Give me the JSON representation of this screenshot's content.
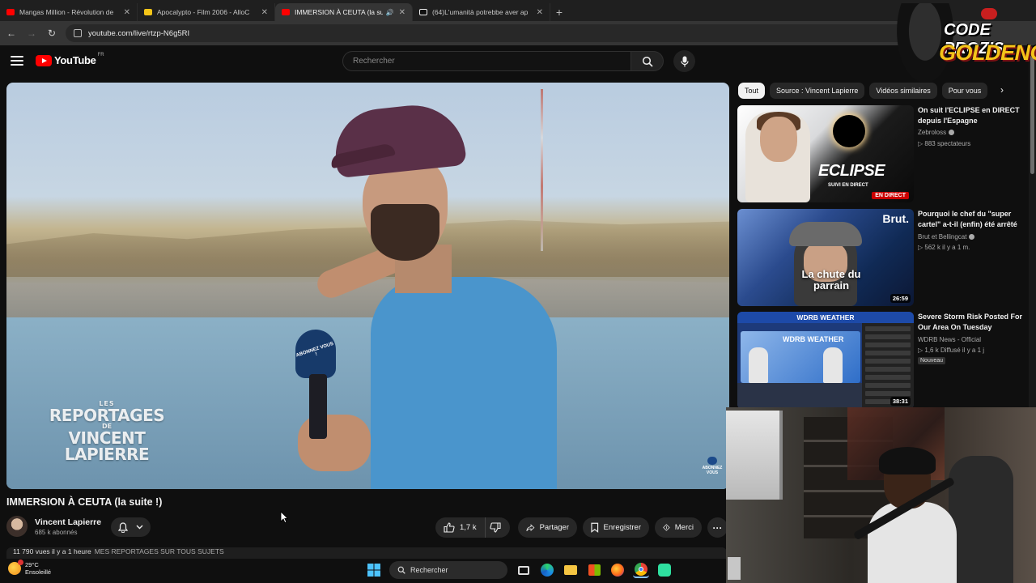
{
  "browser": {
    "tabs": [
      {
        "title": "Mangas Million - Révolution de",
        "favicon_color": "#ff0000",
        "active": false
      },
      {
        "title": "Apocalypto - Film 2006 - AlloC",
        "favicon_color": "#f5c518",
        "active": false
      },
      {
        "title": "IMMERSION À CEUTA (la su",
        "favicon_color": "#ff0000",
        "active": true,
        "audio": true
      },
      {
        "title": "(64)L'umanità potrebbe aver ap",
        "favicon_color": "#ffffff",
        "active": false
      }
    ],
    "url": "youtube.com/live/rtzp-N6g5RI"
  },
  "youtube": {
    "logo_text": "YouTube",
    "country_code": "FR",
    "search_placeholder": "Rechercher"
  },
  "video": {
    "watermark": {
      "line1": "LES",
      "line2": "REPORTAGES",
      "line3": "DE",
      "line4": "VINCENT LAPIERRE"
    },
    "mic_text": "ABONNEZ VOUS !",
    "corner_text": "ABONNEZ VOUS",
    "title": "IMMERSION À CEUTA (la suite !)",
    "channel": "Vincent Lapierre",
    "subscribers": "685 k abonnés",
    "likes": "1,7 k",
    "share_label": "Partager",
    "save_label": "Enregistrer",
    "thanks_label": "Merci",
    "description_start": "11 790 vues  il y a 1 heure",
    "description_link": "MES REPORTAGES SUR TOUS SUJETS"
  },
  "chips": [
    "Tout",
    "Source : Vincent Lapierre",
    "Vidéos similaires",
    "Pour vous"
  ],
  "recommendations": [
    {
      "title": "On suit l'ECLIPSE en DIRECT depuis l'Espagne",
      "channel": "Zebrolоss",
      "verified": true,
      "meta": "▷ 883 spectateurs",
      "thumb_word": "ECLIPSE",
      "thumb_sub": "SUIVI EN DIRECT",
      "badge": "EN DIRECT"
    },
    {
      "title": "Pourquoi le chef du \"super cartel\" a-t-il (enfin) été arrêté",
      "channel": "Brut et Bellingcat",
      "verified": true,
      "meta": "▷ 562 k  il y a 1 m.",
      "thumb_brand": "Brut.",
      "thumb_caption": "La chute du parrain",
      "duration": "26:59"
    },
    {
      "title": "Severe Storm Risk Posted For Our Area On Tuesday",
      "channel": "WDRB News - Official",
      "verified": false,
      "meta": "▷ 1,6 k  Diffusé il y a 1 j",
      "tag": "Nouveau",
      "thumb_banner": "WDRB WEATHER",
      "thumb_screen": "WDRB WEATHER",
      "duration": "38:31"
    }
  ],
  "overlay": {
    "logo_line1": "CODE PROZIS",
    "logo_line2": "GOLDENG"
  },
  "taskbar": {
    "temperature": "29°C",
    "weather": "Ensoleillé",
    "search_label": "Rechercher"
  }
}
